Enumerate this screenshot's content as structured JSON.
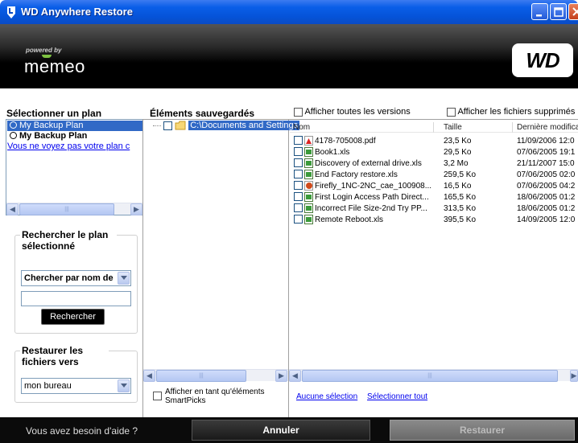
{
  "window": {
    "title": "WD Anywhere Restore"
  },
  "brand": {
    "powered_by": "powered by",
    "product": "memeo",
    "vendor_logo": "WD"
  },
  "plans": {
    "header": "Sélectionner un plan",
    "items": [
      {
        "label": "My Backup Plan",
        "selected": true
      },
      {
        "label": "My Backup Plan",
        "selected": false
      }
    ],
    "missing_link": "Vous ne voyez pas votre plan c"
  },
  "search": {
    "legend": "Rechercher le plan sélectionné",
    "mode": "Chercher par nom de",
    "query": "",
    "button": "Rechercher"
  },
  "restore_to": {
    "legend": "Restaurer les fichiers vers",
    "destination": "mon bureau"
  },
  "backed_up": {
    "header": "Éléments sauvegardés",
    "tree_root": "C:\\Documents and Settings",
    "smartpicks_label": "Afficher en tant qu'éléments SmartPicks"
  },
  "options": {
    "all_versions": "Afficher toutes les versions",
    "deleted_files": "Afficher les fichiers supprimés"
  },
  "files": {
    "columns": [
      "Nom",
      "Taille",
      "Dernière modifica"
    ],
    "rows": [
      {
        "name": "4178-705008.pdf",
        "size": "23,5 Ko",
        "modified": "11/09/2006 12:0",
        "type": "pdf"
      },
      {
        "name": "Book1.xls",
        "size": "29,5 Ko",
        "modified": "07/06/2005 19:1",
        "type": "xls"
      },
      {
        "name": "Discovery of external drive.xls",
        "size": "3,2 Mo",
        "modified": "21/11/2007 15:0",
        "type": "xls"
      },
      {
        "name": "End Factory restore.xls",
        "size": "259,5 Ko",
        "modified": "07/06/2005 02:0",
        "type": "xls"
      },
      {
        "name": "Firefly_1NC-2NC_cae_100908...",
        "size": "16,5 Ko",
        "modified": "07/06/2005 04:2",
        "type": "ppt"
      },
      {
        "name": "First Login Access Path Direct...",
        "size": "165,5 Ko",
        "modified": "18/06/2005 01:2",
        "type": "xls"
      },
      {
        "name": "Incorrect File Size-2nd Try PP...",
        "size": "313,5 Ko",
        "modified": "18/06/2005 01:2",
        "type": "xls"
      },
      {
        "name": "Remote Reboot.xls",
        "size": "395,5 Ko",
        "modified": "14/09/2005 12:0",
        "type": "xls"
      }
    ],
    "select_none": "Aucune sélection",
    "select_all": "Sélectionner tout"
  },
  "footer": {
    "help": "Vous avez besoin d'aide ?",
    "cancel": "Annuler",
    "restore": "Restaurer"
  }
}
